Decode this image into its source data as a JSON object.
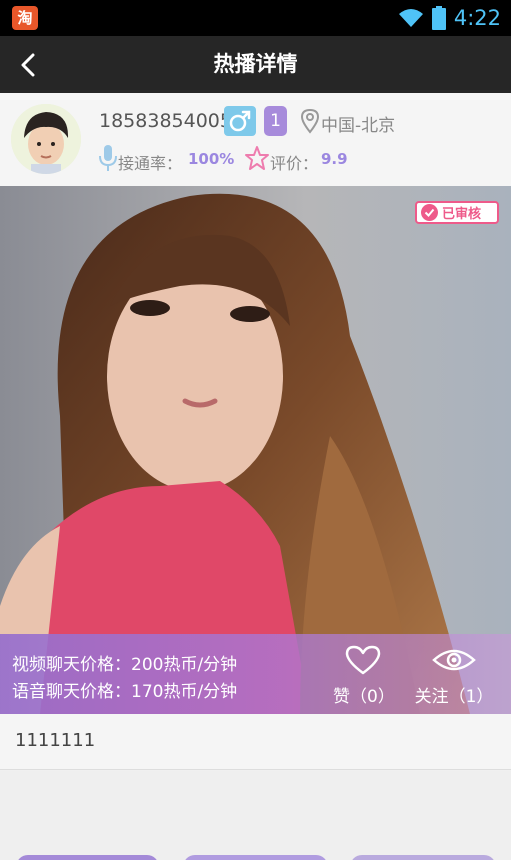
{
  "status_bar": {
    "app_icon_glyph": "淘",
    "time": "4:22"
  },
  "header": {
    "title": "热播详情"
  },
  "profile": {
    "phone": "18583854005",
    "level": "1",
    "location": "中国-北京",
    "connect_rate_label": "接通率：",
    "connect_rate_value": "100%",
    "rating_label": "评价：",
    "rating_value": "9.9"
  },
  "photo": {
    "verified_label": "已审核"
  },
  "pricing": {
    "video": "视频聊天价格：200热币/分钟",
    "voice": "语音聊天价格：170热币/分钟"
  },
  "actions": {
    "like_label": "赞（0）",
    "follow_label": "关注（1）"
  },
  "description": "1111111",
  "colors": {
    "accent_purple": "#9b87e0",
    "gender_blue": "#7ec9ea",
    "verified_pink": "#ee5a8a",
    "header_bg": "#262626"
  },
  "icons": [
    "taobao-icon",
    "wifi-icon",
    "battery-icon",
    "back-chevron-icon",
    "male-icon",
    "location-pin-icon",
    "microphone-icon",
    "star-icon",
    "check-circle-icon",
    "heart-icon",
    "eye-icon"
  ]
}
